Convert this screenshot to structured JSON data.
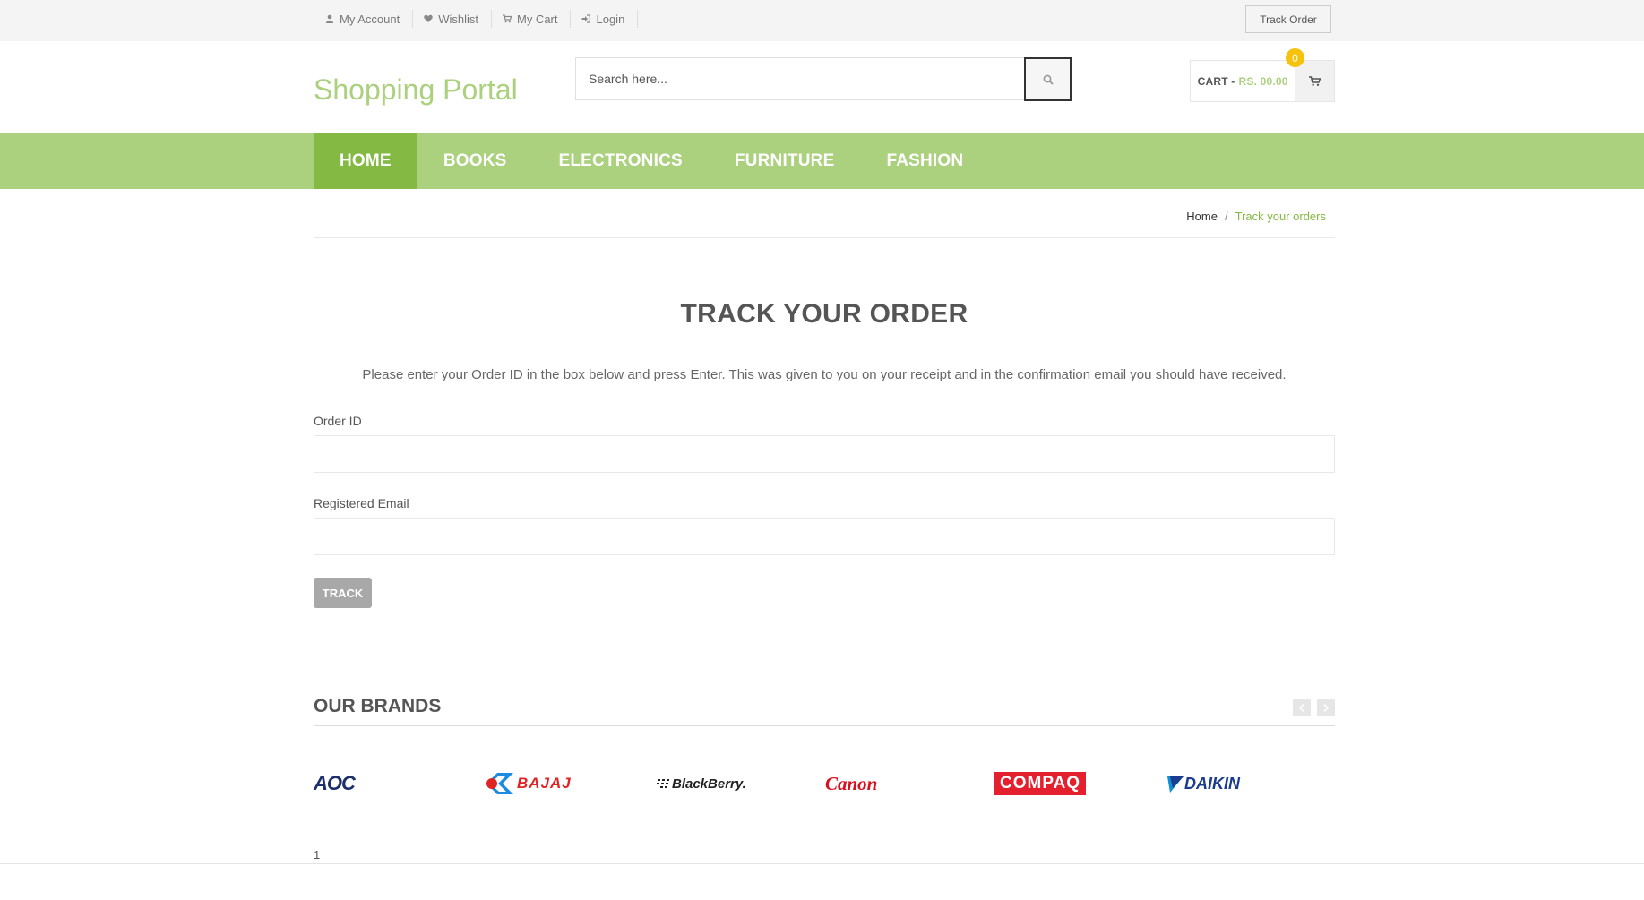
{
  "topbar": {
    "links": [
      {
        "label": "My Account",
        "icon": "user-icon"
      },
      {
        "label": "Wishlist",
        "icon": "heart-icon"
      },
      {
        "label": "My Cart",
        "icon": "cart-icon"
      },
      {
        "label": "Login",
        "icon": "sign-in-icon"
      }
    ],
    "track_order_label": "Track Order"
  },
  "header": {
    "logo": "Shopping Portal",
    "search_placeholder": "Search here...",
    "cart_label": "CART -",
    "cart_amount": "RS. 00.00",
    "cart_count": "0"
  },
  "nav": {
    "items": [
      "HOME",
      "BOOKS",
      "ELECTRONICS",
      "FURNITURE",
      "FASHION"
    ],
    "active": "HOME"
  },
  "breadcrumb": {
    "home": "Home",
    "separator": "/",
    "current": "Track your orders"
  },
  "main": {
    "title": "TRACK YOUR ORDER",
    "instructions": "Please enter your Order ID in the box below and press Enter. This was given to you on your receipt and in the confirmation email you should have received.",
    "order_id_label": "Order ID",
    "email_label": "Registered Email",
    "track_button": "TRACK"
  },
  "brands": {
    "title": "OUR BRANDS",
    "logos": [
      "AOC",
      "BAJAJ",
      "BlackBerry.",
      "Canon",
      "COMPAQ",
      "DAIKIN"
    ],
    "page_number": "1"
  },
  "colors": {
    "accent_green": "#abd07e",
    "active_green": "#84b943",
    "badge_yellow": "#f6c30a"
  }
}
